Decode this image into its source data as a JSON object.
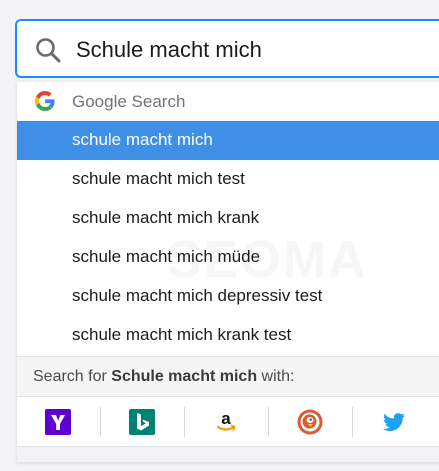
{
  "search": {
    "value": "Schule macht mich"
  },
  "provider": {
    "name": "Google Search",
    "icon": "google-icon"
  },
  "suggestions": [
    {
      "text": "schule macht mich",
      "selected": true
    },
    {
      "text": "schule macht mich test",
      "selected": false
    },
    {
      "text": "schule macht mich krank",
      "selected": false
    },
    {
      "text": "schule macht mich müde",
      "selected": false
    },
    {
      "text": "schule macht mich depressiv test",
      "selected": false
    },
    {
      "text": "schule macht mich krank test",
      "selected": false
    }
  ],
  "footer": {
    "prefix": "Search for ",
    "query": "Schule macht mich",
    "suffix": " with:"
  },
  "engines": [
    {
      "icon": "yahoo-icon",
      "color": "#5f01d1"
    },
    {
      "icon": "bing-icon",
      "color": "#008373"
    },
    {
      "icon": "amazon-icon",
      "color": "#ff9900"
    },
    {
      "icon": "duckduckgo-icon",
      "color": "#de5833"
    },
    {
      "icon": "twitter-icon",
      "color": "#1da1f2"
    }
  ],
  "colors": {
    "accent": "#1a8cff",
    "selected_row": "#3f8fe6"
  }
}
